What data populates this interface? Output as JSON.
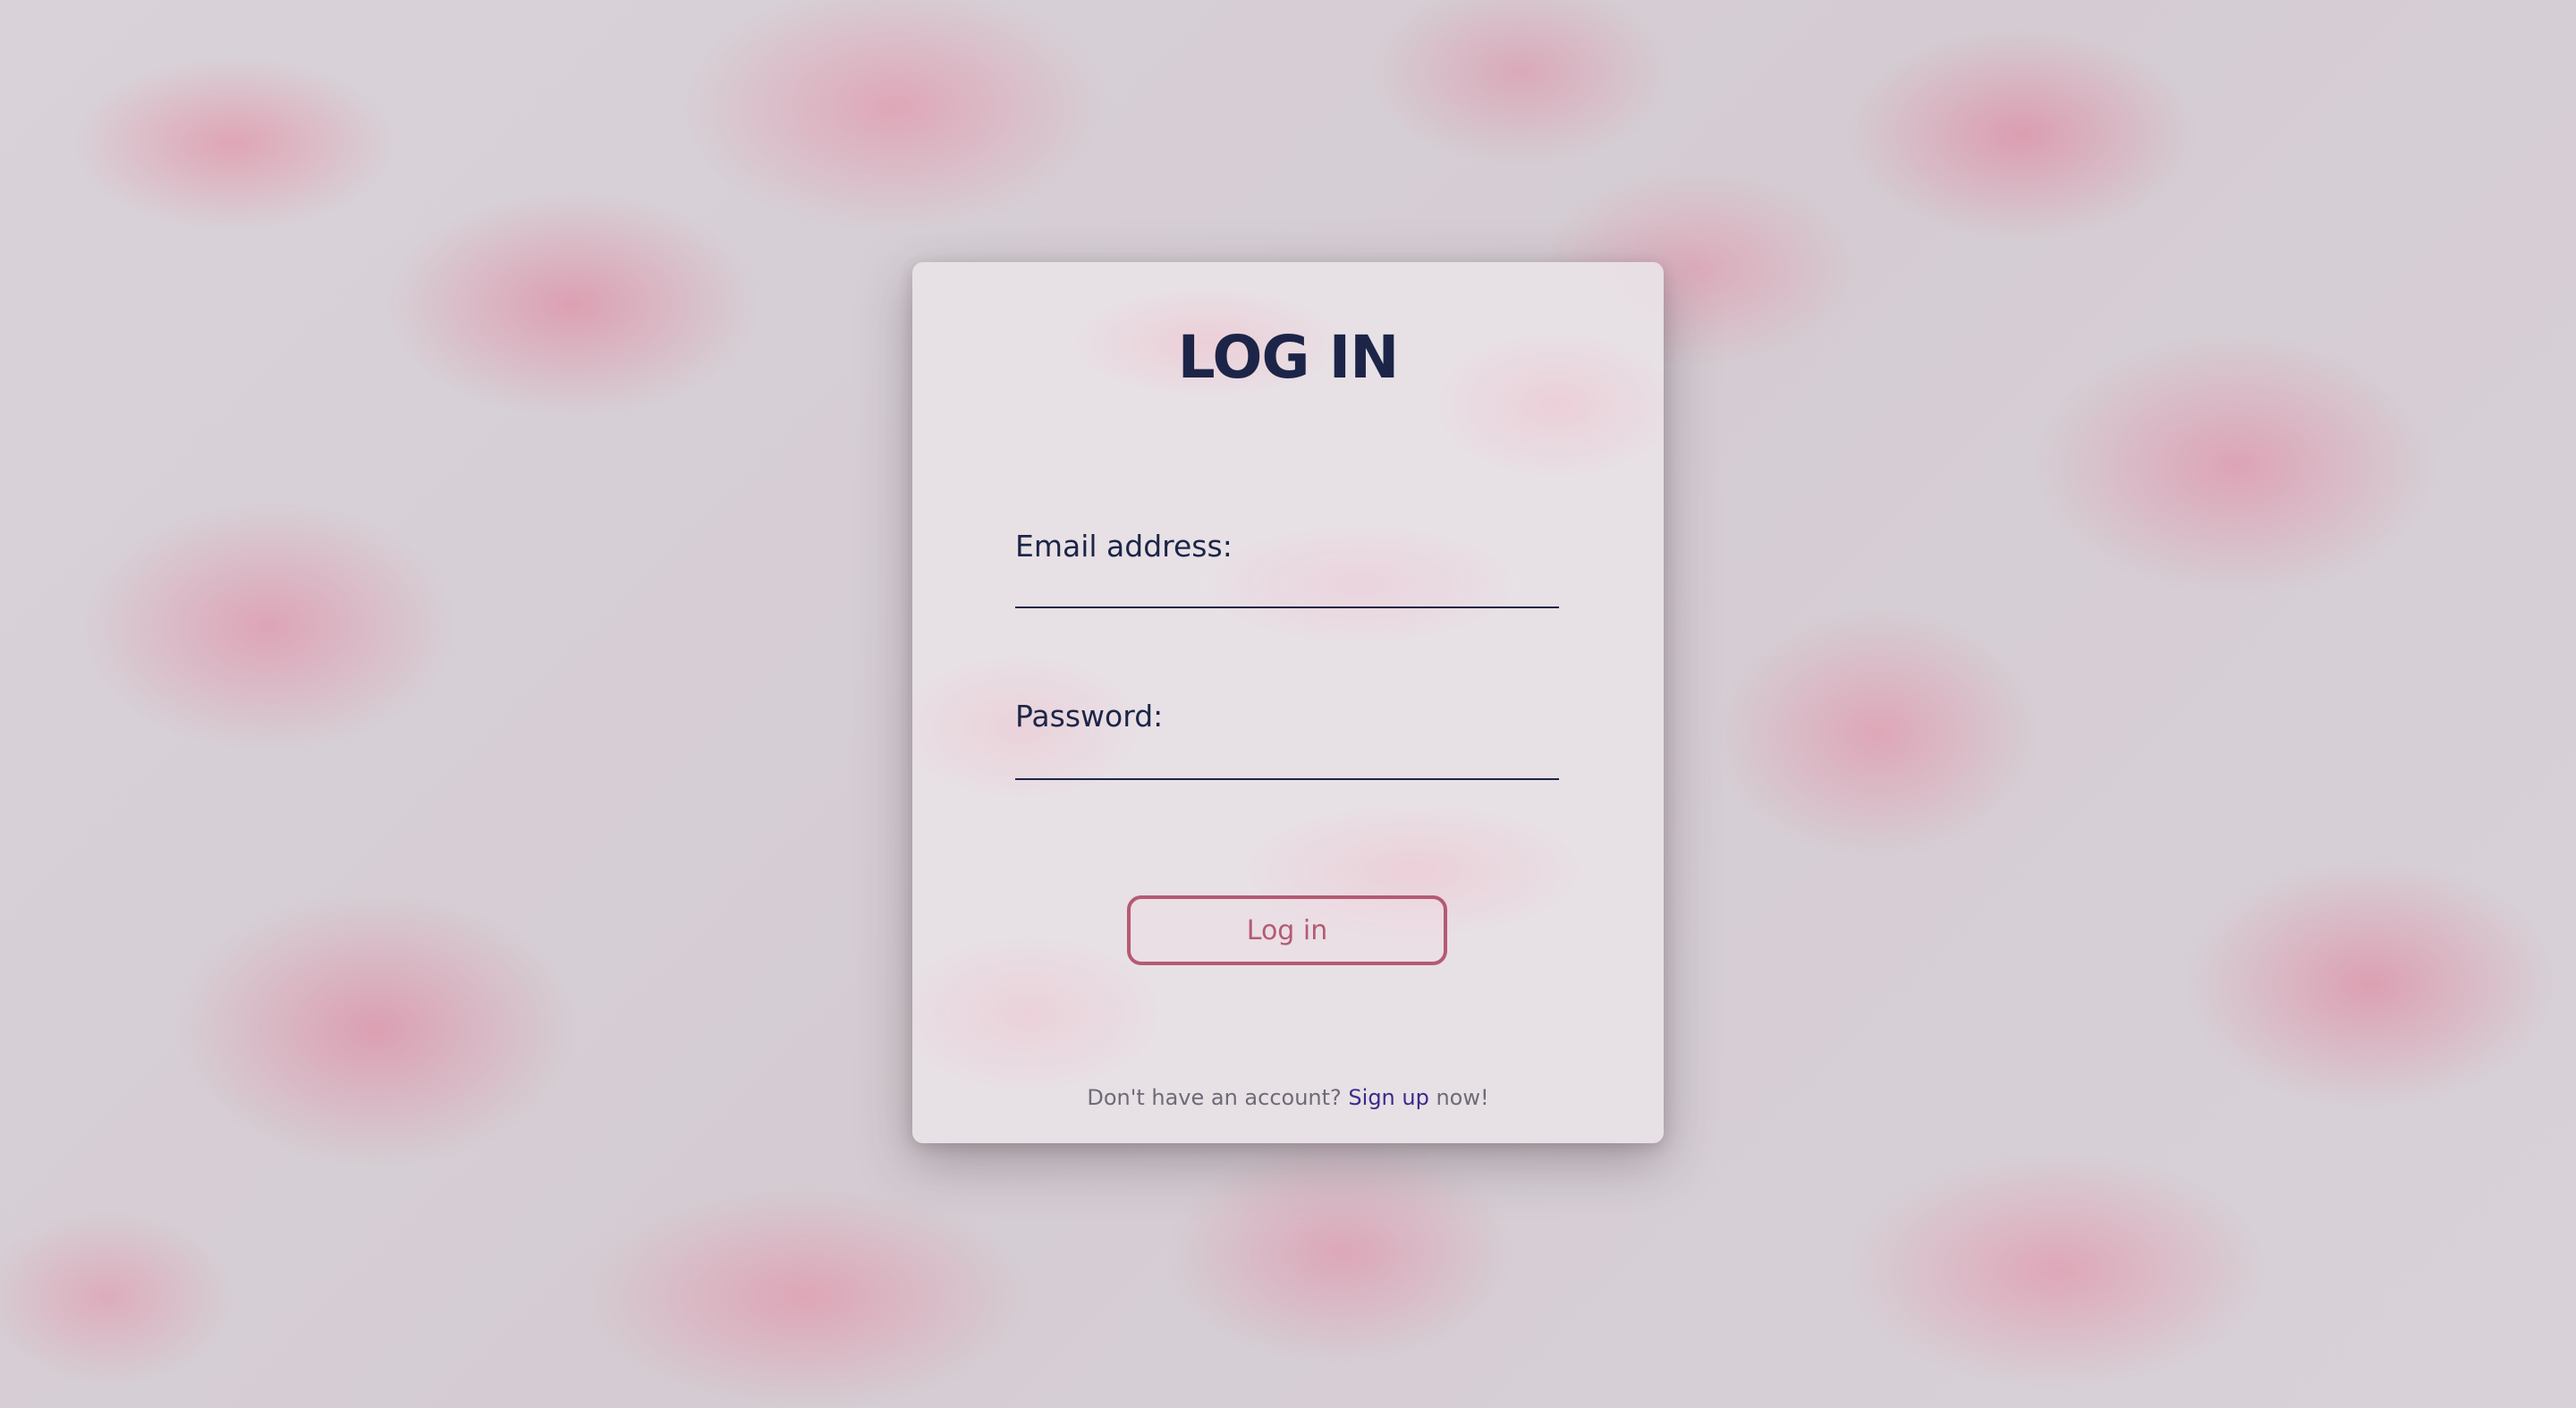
{
  "login_card": {
    "title": "LOG IN",
    "email_label": "Email address:",
    "email_value": "",
    "password_label": "Password:",
    "password_value": "",
    "submit_label": "Log in",
    "signup_prefix": "Don't have an account? ",
    "signup_link": "Sign up",
    "signup_suffix": " now!"
  },
  "colors": {
    "heading": "#1c2548",
    "button_accent": "#b55a74",
    "link": "#3b2a8c",
    "muted_text": "#6e6a78"
  }
}
